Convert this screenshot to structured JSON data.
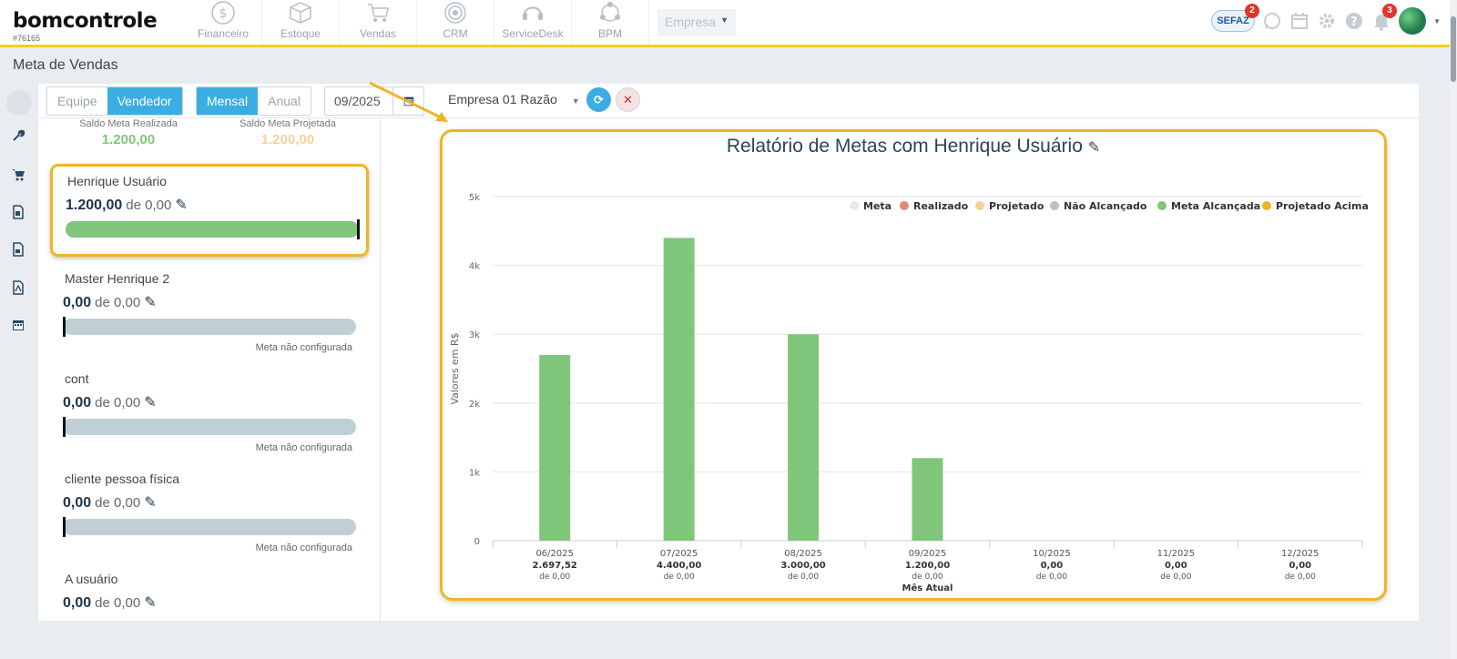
{
  "app": {
    "logo": "bomcontrole",
    "account_id": "#76165",
    "modules": [
      {
        "label": "Financeiro",
        "icon": "dollar-coin-icon"
      },
      {
        "label": "Estoque",
        "icon": "box-icon"
      },
      {
        "label": "Vendas",
        "icon": "cart-icon"
      },
      {
        "label": "CRM",
        "icon": "target-icon"
      },
      {
        "label": "ServiceDesk",
        "icon": "headset-icon"
      },
      {
        "label": "BPM",
        "icon": "network-icon"
      }
    ],
    "empresa_select": "Empresa",
    "sefaz_label": "SEFAZ",
    "sefaz_badge": "2",
    "notifications_badge": "3"
  },
  "page": {
    "title": "Meta de Vendas"
  },
  "toolbar": {
    "scope_options": [
      "Equipe",
      "Vendedor"
    ],
    "scope_selected": "Vendedor",
    "period_options": [
      "Mensal",
      "Anual"
    ],
    "period_selected": "Mensal",
    "date": "09/2025",
    "empresa": "Empresa 01 Razão"
  },
  "summary": {
    "realizada_label": "Saldo Meta Realizada",
    "realizada_value": "1.200,00",
    "projetada_label": "Saldo Meta Projetada",
    "projetada_value": "1.200,00"
  },
  "sellers": [
    {
      "name": "Henrique Usuário",
      "value": "1.200,00",
      "of": "de 0,00",
      "progress": 1.0,
      "note": ""
    },
    {
      "name": "Master Henrique 2",
      "value": "0,00",
      "of": "de 0,00",
      "progress": 0,
      "note": "Meta não configurada"
    },
    {
      "name": "cont",
      "value": "0,00",
      "of": "de 0,00",
      "progress": 0,
      "note": "Meta não configurada"
    },
    {
      "name": "cliente pessoa física",
      "value": "0,00",
      "of": "de 0,00",
      "progress": 0,
      "note": "Meta não configurada"
    },
    {
      "name": "A usuário",
      "value": "0,00",
      "of": "de 0,00",
      "progress": 0,
      "note": ""
    }
  ],
  "colors": {
    "accent": "#3aaee3",
    "highlight": "#f0b429",
    "meta": "#e6e8eb",
    "realizado": "#e5887c",
    "projetado": "#f4d19b",
    "nao_alcancado": "#b5c3cc",
    "meta_alcancada": "#7fc67a",
    "projetado_acima": "#f0b429"
  },
  "chart_data": {
    "type": "bar",
    "title": "Relatório de Metas com Henrique Usuário",
    "ylabel": "Valores em R$",
    "ylim": [
      0,
      5000
    ],
    "yticks": [
      "0",
      "1k",
      "2k",
      "3k",
      "4k",
      "5k"
    ],
    "legend_position": "top-right",
    "legend": [
      "Meta",
      "Realizado",
      "Projetado",
      "Não Alcançado",
      "Meta Alcançada",
      "Projetado Acima"
    ],
    "categories": [
      "06/2025",
      "07/2025",
      "08/2025",
      "09/2025",
      "10/2025",
      "11/2025",
      "12/2025"
    ],
    "category_values": [
      "2.697,52",
      "4.400,00",
      "3.000,00",
      "1.200,00",
      "0,00",
      "0,00",
      "0,00"
    ],
    "category_goals": [
      "de 0,00",
      "de 0,00",
      "de 0,00",
      "de 0,00",
      "de 0,00",
      "de 0,00",
      "de 0,00"
    ],
    "current_month_label": "Mês Atual",
    "current_month_index": 3,
    "series": [
      {
        "name": "Meta Alcançada",
        "values": [
          2697.52,
          4400,
          3000,
          1200,
          0,
          0,
          0
        ]
      }
    ]
  }
}
